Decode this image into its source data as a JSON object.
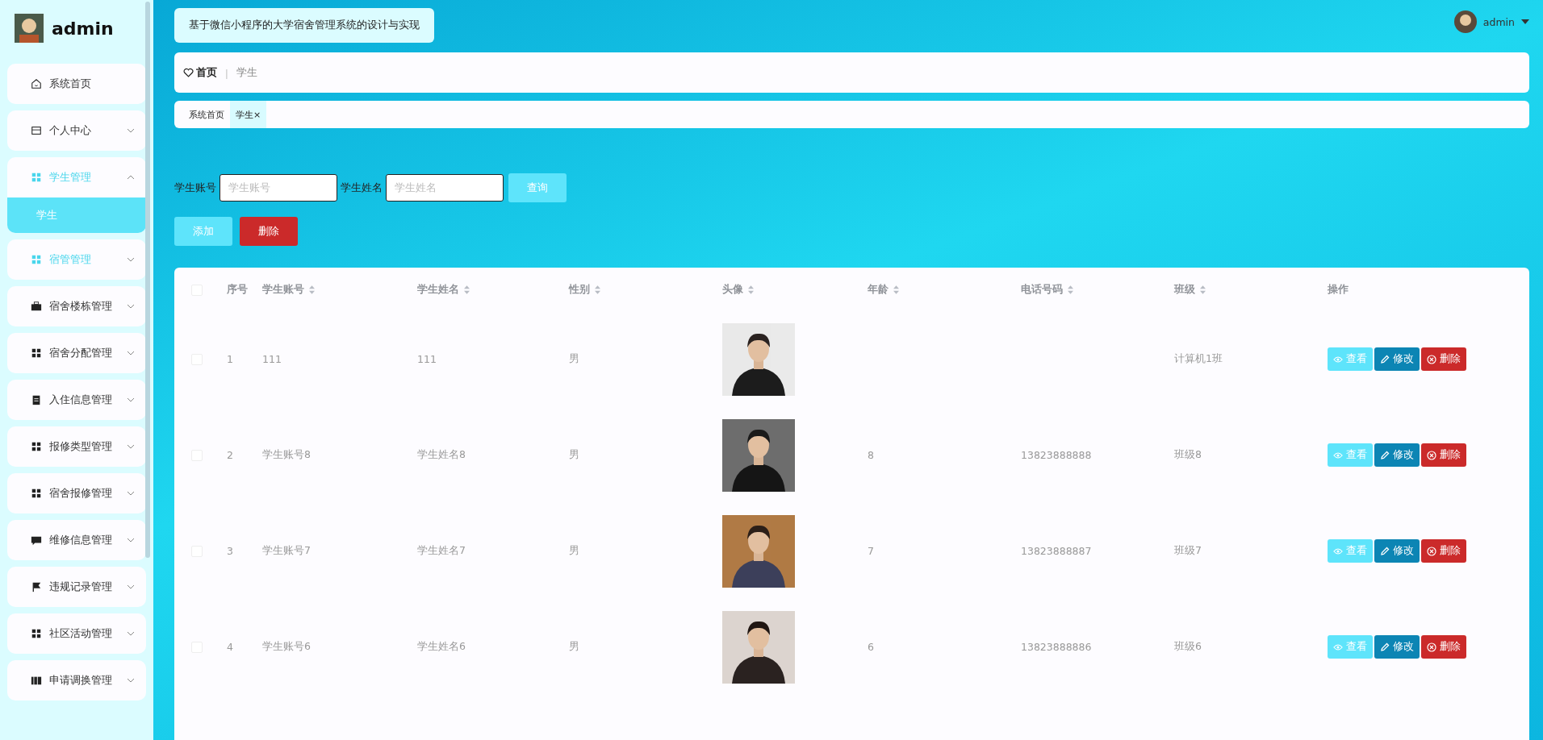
{
  "sidebar": {
    "user": "admin",
    "items": [
      {
        "label": "系统首页",
        "kind": "home",
        "hovered": false
      },
      {
        "label": "个人中心",
        "kind": "card",
        "expanded": false,
        "hovered": false
      },
      {
        "label": "学生管理",
        "kind": "grid",
        "expanded": true,
        "hovered": false,
        "children": [
          {
            "label": "学生",
            "selected": true
          }
        ]
      },
      {
        "label": "宿管管理",
        "kind": "grid",
        "expanded": false,
        "hovered": true
      },
      {
        "label": "宿舍楼栋管理",
        "kind": "briefcase",
        "expanded": false,
        "hovered": false
      },
      {
        "label": "宿舍分配管理",
        "kind": "grid",
        "expanded": false,
        "hovered": false
      },
      {
        "label": "入住信息管理",
        "kind": "clipboard",
        "expanded": false,
        "hovered": false
      },
      {
        "label": "报修类型管理",
        "kind": "grid",
        "expanded": false,
        "hovered": false
      },
      {
        "label": "宿舍报修管理",
        "kind": "grid",
        "expanded": false,
        "hovered": false
      },
      {
        "label": "维修信息管理",
        "kind": "chat",
        "expanded": false,
        "hovered": false
      },
      {
        "label": "违规记录管理",
        "kind": "flag",
        "expanded": false,
        "hovered": false
      },
      {
        "label": "社区活动管理",
        "kind": "grid",
        "expanded": false,
        "hovered": false
      },
      {
        "label": "申请调换管理",
        "kind": "book",
        "expanded": false,
        "hovered": false
      }
    ]
  },
  "header": {
    "title": "基于微信小程序的大学宿舍管理系统的设计与实现",
    "user": "admin"
  },
  "breadcrumb": {
    "home": "首页",
    "separator": "ǀ",
    "current": "学生"
  },
  "tabs": [
    {
      "label": "系统首页",
      "selected": false
    },
    {
      "label": "学生",
      "selected": true,
      "close": "×"
    }
  ],
  "search": {
    "fields": [
      {
        "label": "学生账号",
        "placeholder": "学生账号"
      },
      {
        "label": "学生姓名",
        "placeholder": "学生姓名"
      }
    ],
    "button": "查询"
  },
  "actions": {
    "add": "添加",
    "delete": "删除"
  },
  "table": {
    "select_all": {
      "checked": false
    },
    "columns": [
      {
        "label": "序号",
        "sortable": false
      },
      {
        "label": "学生账号",
        "sortable": true
      },
      {
        "label": "学生姓名",
        "sortable": true
      },
      {
        "label": "性别",
        "sortable": true
      },
      {
        "label": "头像",
        "sortable": true
      },
      {
        "label": "年龄",
        "sortable": true
      },
      {
        "label": "电话号码",
        "sortable": true
      },
      {
        "label": "班级",
        "sortable": true
      },
      {
        "label": "操作",
        "sortable": false
      }
    ],
    "rows": [
      {
        "checked": false,
        "index": "1",
        "account": "111",
        "name": "111",
        "gender": "男",
        "avatar": {
          "kind": "picture"
        },
        "class": "计算机1班",
        "actions": [
          "查看",
          "修改",
          "删除"
        ]
      },
      {
        "checked": false,
        "index": "2",
        "account": "学生账号8",
        "name": "学生姓名8",
        "gender": "男",
        "avatar": {
          "kind": "picture"
        },
        "age": "8",
        "phone": "13823888888",
        "class": "班级8",
        "actions": [
          "查看",
          "修改",
          "删除"
        ]
      },
      {
        "checked": false,
        "index": "3",
        "account": "学生账号7",
        "name": "学生姓名7",
        "gender": "男",
        "avatar": {
          "kind": "picture"
        },
        "age": "7",
        "phone": "13823888887",
        "class": "班级7",
        "actions": [
          "查看",
          "修改",
          "删除"
        ]
      },
      {
        "checked": false,
        "index": "4",
        "account": "学生账号6",
        "name": "学生姓名6",
        "gender": "男",
        "avatar": {
          "kind": "picture"
        },
        "age": "6",
        "phone": "13823888886",
        "class": "班级6",
        "actions": [
          "查看",
          "修改",
          "删除"
        ]
      }
    ]
  }
}
